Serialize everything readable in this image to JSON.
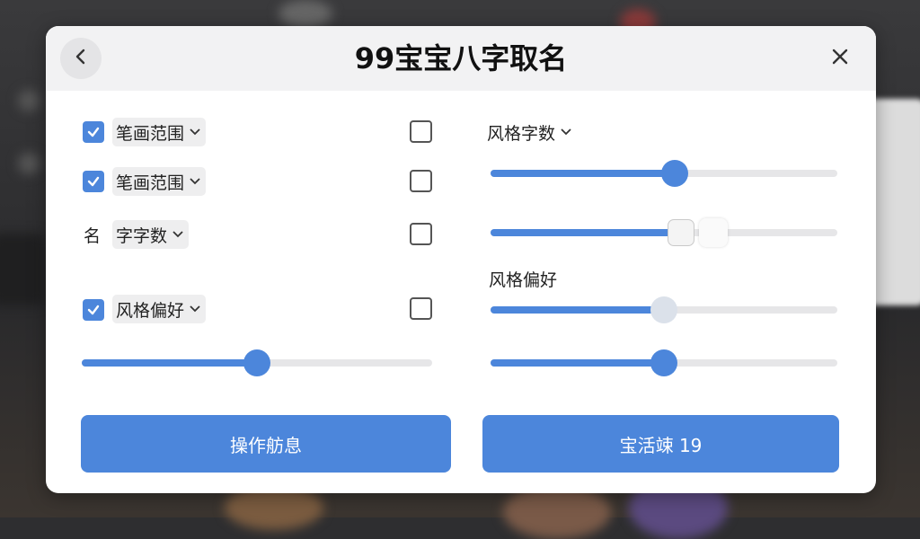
{
  "dialog": {
    "title": "99宝宝八字取名",
    "back_icon": "chevron-left-icon",
    "close_icon": "close-icon"
  },
  "left_rows": [
    {
      "checked": true,
      "dropdown_label": "笔画范围",
      "right_checkbox_checked": false
    },
    {
      "checked": true,
      "dropdown_label": "笔画范围",
      "right_checkbox_checked": false
    },
    {
      "prefix_label": "名",
      "dropdown_label": "字字数",
      "right_checkbox_checked": false
    },
    {
      "checked": true,
      "dropdown_label": "风格偏好",
      "right_checkbox_checked": false
    }
  ],
  "left_slider": {
    "value": 0.5
  },
  "right_panel": {
    "dropdown_label": "风格字数",
    "section_label": "风格偏好",
    "sliders": [
      {
        "value": 0.53
      },
      {
        "value": 0.55
      },
      {
        "value": 0.5
      },
      {
        "value": 0.5
      }
    ]
  },
  "buttons": {
    "left_label": "操作舫息",
    "right_label": "宝活竦 19"
  },
  "colors": {
    "accent": "#4c86db",
    "track": "#e6e6e8",
    "header_bg": "#f2f2f3"
  }
}
